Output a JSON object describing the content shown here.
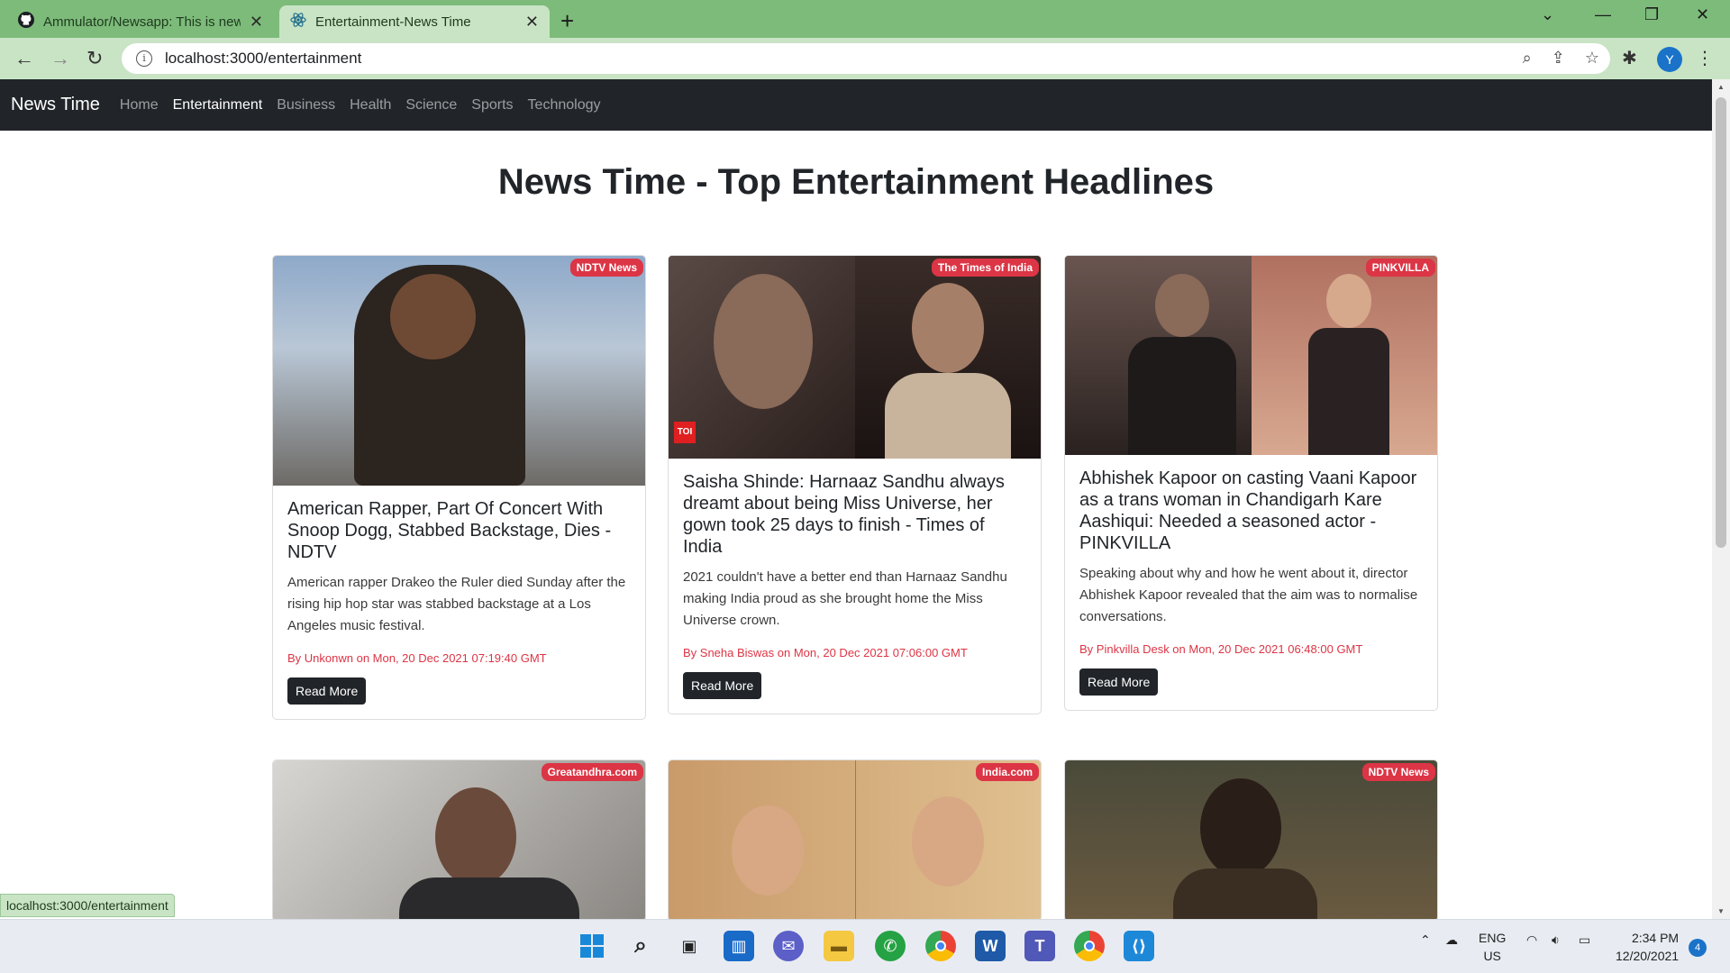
{
  "browser": {
    "tabs": [
      {
        "title": "Ammulator/Newsapp: This is new",
        "icon": "github-icon"
      },
      {
        "title": "Entertainment-News Time",
        "icon": "react-icon"
      }
    ],
    "url": "localhost:3000/entertainment",
    "profile_initial": "Y",
    "status_url": "localhost:3000/entertainment"
  },
  "nav": {
    "brand": "News Time",
    "links": [
      "Home",
      "Entertainment",
      "Business",
      "Health",
      "Science",
      "Sports",
      "Technology"
    ],
    "active": "Entertainment"
  },
  "page": {
    "heading": "News Time - Top Entertainment Headlines",
    "read_more": "Read More"
  },
  "articles": [
    {
      "source": "NDTV News",
      "title": "American Rapper, Part Of Concert With Snoop Dogg, Stabbed Backstage, Dies - NDTV",
      "description": "American rapper Drakeo the Ruler died Sunday after the rising hip hop star was stabbed backstage at a Los Angeles music festival.",
      "meta": "By Unkonwn on Mon, 20 Dec 2021 07:19:40 GMT"
    },
    {
      "source": "The Times of India",
      "title": "Saisha Shinde: Harnaaz Sandhu always dreamt about being Miss Universe, her gown took 25 days to finish - Times of India",
      "description": "2021 couldn't have a better end than Harnaaz Sandhu making India proud as she brought home the Miss Universe crown.",
      "meta": "By Sneha Biswas on Mon, 20 Dec 2021 07:06:00 GMT",
      "logo_text": "TOI"
    },
    {
      "source": "PINKVILLA",
      "title": "Abhishek Kapoor on casting Vaani Kapoor as a trans woman in Chandigarh Kare Aashiqui: Needed a seasoned actor - PINKVILLA",
      "description": "Speaking about why and how he went about it, director Abhishek Kapoor revealed that the aim was to normalise conversations.",
      "meta": "By Pinkvilla Desk on Mon, 20 Dec 2021 06:48:00 GMT"
    },
    {
      "source": "Greatandhra.com"
    },
    {
      "source": "India.com"
    },
    {
      "source": "NDTV News"
    }
  ],
  "taskbar": {
    "apps": [
      "windows-start-icon",
      "search-icon",
      "task-view-icon",
      "widgets-icon",
      "chat-icon",
      "file-explorer-icon",
      "whatsapp-icon",
      "chrome-icon",
      "word-icon",
      "teams-icon",
      "chrome-profile-icon",
      "vscode-icon"
    ],
    "lang_line1": "ENG",
    "lang_line2": "US",
    "time": "2:34 PM",
    "date": "12/20/2021",
    "notifications": "4"
  },
  "colors": {
    "browser_frame": "#7dbb7a",
    "navbar_bg": "#212529",
    "badge": "#dc3545",
    "meta_text": "#dc3545",
    "button_bg": "#212529"
  }
}
